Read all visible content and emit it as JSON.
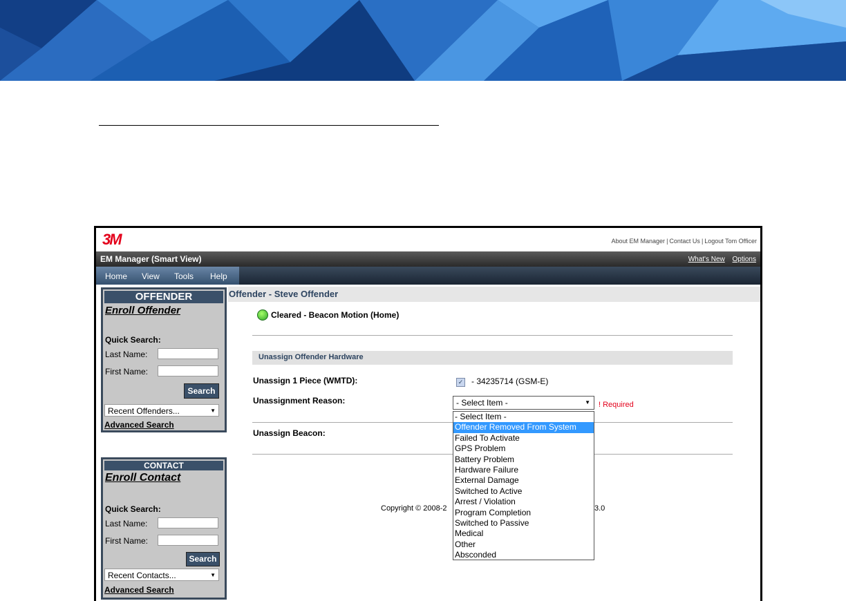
{
  "header": {
    "brand_logo": "3M"
  },
  "top_links": [
    "About EM Manager",
    "Contact Us",
    "Logout Tom Officer"
  ],
  "title_bar": {
    "app_title": "EM Manager (Smart View)",
    "whats_new": "What's New",
    "options": "Options"
  },
  "menu": [
    "Home",
    "View",
    "Tools",
    "Help"
  ],
  "offender_panel": {
    "heading": "OFFENDER",
    "enroll": "Enroll Offender",
    "quick_search": "Quick Search:",
    "last_name_label": "Last Name:",
    "first_name_label": "First Name:",
    "search_button": "Search",
    "recent": "Recent Offenders...",
    "advanced": "Advanced Search"
  },
  "contact_panel": {
    "heading": "CONTACT",
    "enroll": "Enroll Contact",
    "quick_search": "Quick Search:",
    "last_name_label": "Last Name:",
    "first_name_label": "First Name:",
    "search_button": "Search",
    "recent": "Recent Contacts...",
    "advanced": "Advanced Search"
  },
  "main": {
    "page_title": "Offender - Steve Offender",
    "status": "Cleared - Beacon Motion (Home)",
    "status_color": "#2ea42a",
    "section_title": "Unassign Offender Hardware",
    "unassign_piece_label": "Unassign 1 Piece (WMTD):",
    "unassign_piece_value": "- 34235714 (GSM-E)",
    "reason_label": "Unassignment Reason:",
    "reason_selected": "- Select Item -",
    "required": "! Required",
    "beacon_label": "Unassign Beacon:",
    "copyright_left": "Copyright © 2008-2",
    "copyright_right": "3.0"
  },
  "reason_options": [
    "- Select Item -",
    "Offender Removed From System",
    "Failed To Activate",
    "GPS Problem",
    "Battery Problem",
    "Hardware Failure",
    "External Damage",
    "Switched to Active",
    "Arrest / Violation",
    "Program Completion",
    "Switched to Passive",
    "Medical",
    "Other",
    "Absconded"
  ],
  "reason_highlighted": "Offender Removed From System"
}
